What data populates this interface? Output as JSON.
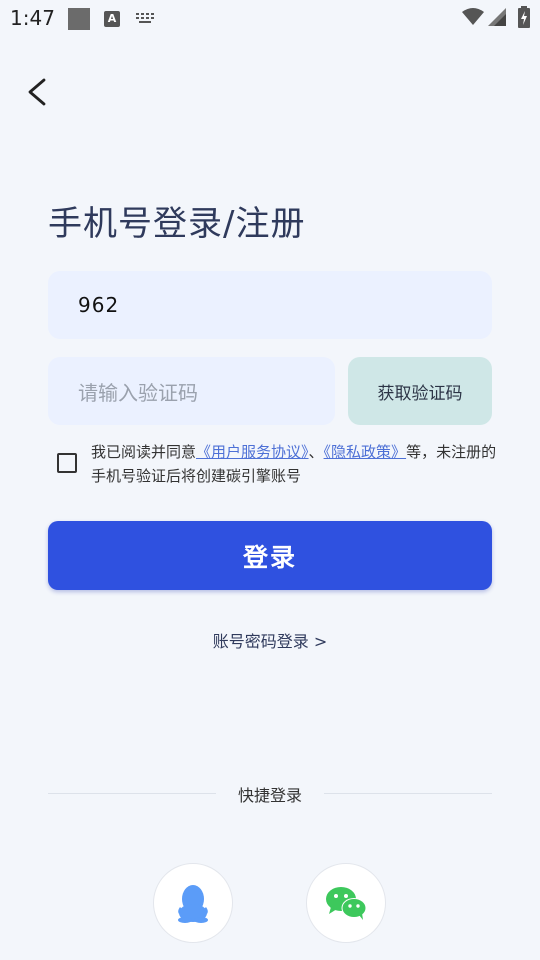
{
  "status_bar": {
    "time": "1:47",
    "notification_icon_letter": "A"
  },
  "login": {
    "title": "手机号登录/注册",
    "phone_value": "962",
    "code_placeholder": "请输入验证码",
    "get_code_label": "获取验证码",
    "agreement": {
      "prefix": "我已阅读并同意",
      "user_agreement": "《用户服务协议》",
      "separator": "、",
      "privacy_policy": "《隐私政策》",
      "suffix": "等，未注册的手机号验证后将创建碳引擎账号"
    },
    "login_label": "登录",
    "account_login_link": "账号密码登录 >"
  },
  "quick_login": {
    "label": "快捷登录",
    "options": [
      {
        "name": "QQ",
        "icon": "qq-icon",
        "color": "#5b9cf8"
      },
      {
        "name": "WeChat",
        "icon": "wechat-icon",
        "color": "#3dc85c"
      }
    ]
  },
  "colors": {
    "background": "#f3f6fb",
    "primary": "#2f51e0",
    "input_bg": "#ebf1ff",
    "get_code_bg": "#cfe7e7",
    "link": "#4d70d6"
  }
}
